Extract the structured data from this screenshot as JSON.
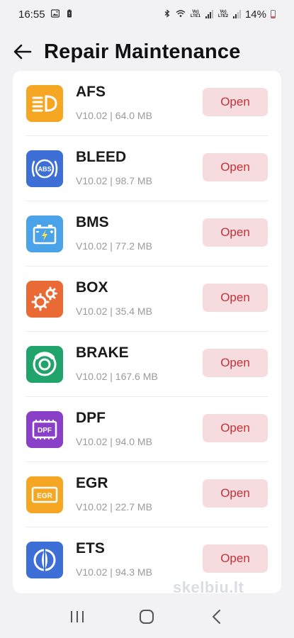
{
  "status_bar": {
    "time": "16:55",
    "battery": "14%",
    "sim1_label": "Vo) LTE1",
    "sim2_label": "Vo) LTE2"
  },
  "header": {
    "title": "Repair Maintenance"
  },
  "apps": [
    {
      "name": "AFS",
      "meta": "V10.02 | 64.0 MB",
      "action": "Open",
      "icon": "headlight-icon",
      "color": "#f5a623"
    },
    {
      "name": "BLEED",
      "meta": "V10.02 | 98.7 MB",
      "action": "Open",
      "icon": "abs-icon",
      "color": "#3d6fd6"
    },
    {
      "name": "BMS",
      "meta": "V10.02 | 77.2 MB",
      "action": "Open",
      "icon": "battery-icon",
      "color": "#4aa3e8"
    },
    {
      "name": "BOX",
      "meta": "V10.02 | 35.4 MB",
      "action": "Open",
      "icon": "gears-icon",
      "color": "#ea6a35"
    },
    {
      "name": "BRAKE",
      "meta": "V10.02 | 167.6 MB",
      "action": "Open",
      "icon": "brake-disc-icon",
      "color": "#21a36c"
    },
    {
      "name": "DPF",
      "meta": "V10.02 | 94.0 MB",
      "action": "Open",
      "icon": "dpf-icon",
      "color": "#8a3fc9"
    },
    {
      "name": "EGR",
      "meta": "V10.02 | 22.7 MB",
      "action": "Open",
      "icon": "egr-icon",
      "color": "#f5a623"
    },
    {
      "name": "ETS",
      "meta": "V10.02 | 94.3 MB",
      "action": "Open",
      "icon": "throttle-icon",
      "color": "#3d6fd6"
    }
  ],
  "icon_text": {
    "abs": "ABS",
    "dpf": "DPF",
    "egr": "EGR"
  },
  "watermark": "skelbiu.lt",
  "colors": {
    "open_bg": "#f6dcde",
    "open_text": "#c0323a",
    "page_bg": "#f2f2f4"
  }
}
